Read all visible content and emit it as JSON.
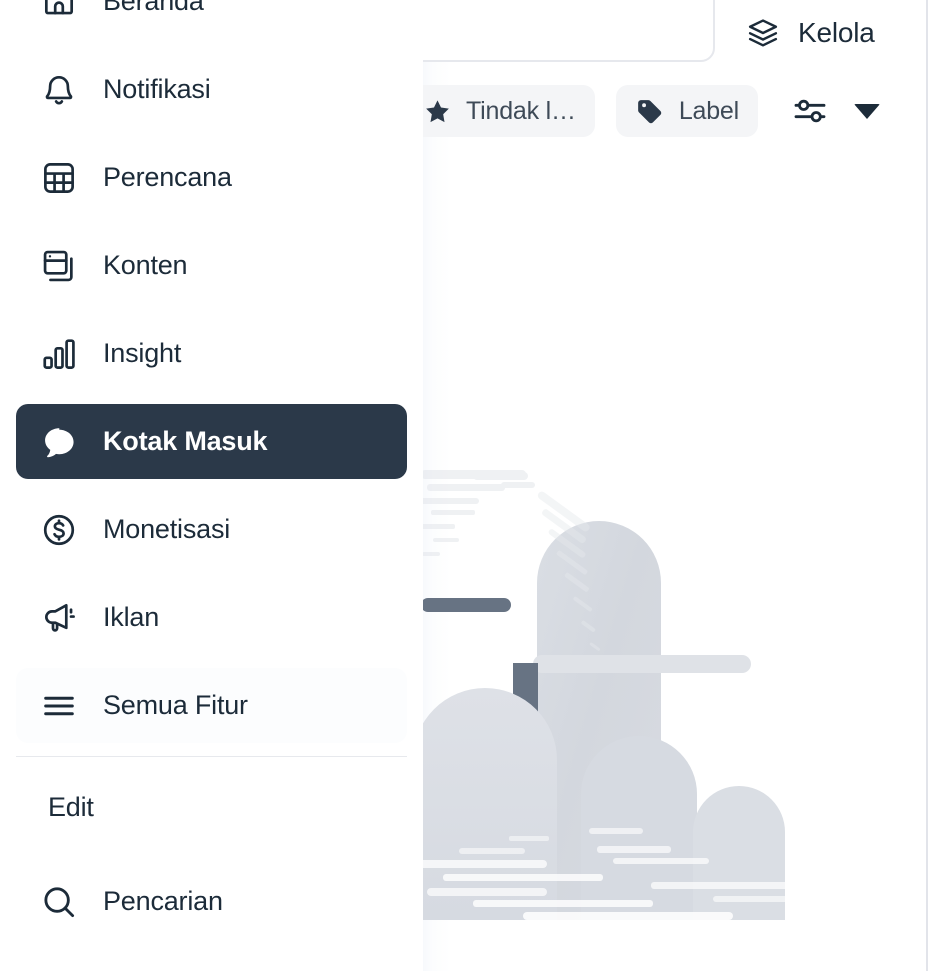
{
  "sidebar": {
    "items": [
      {
        "label": "Beranda",
        "icon": "home-icon",
        "state": "normal"
      },
      {
        "label": "Notifikasi",
        "icon": "bell-icon",
        "state": "normal"
      },
      {
        "label": "Perencana",
        "icon": "calendar-grid-icon",
        "state": "normal"
      },
      {
        "label": "Konten",
        "icon": "content-cards-icon",
        "state": "normal"
      },
      {
        "label": "Insight",
        "icon": "bar-chart-icon",
        "state": "normal"
      },
      {
        "label": "Kotak Masuk",
        "icon": "chat-bubble-icon",
        "state": "active"
      },
      {
        "label": "Monetisasi",
        "icon": "dollar-circle-icon",
        "state": "normal"
      },
      {
        "label": "Iklan",
        "icon": "megaphone-icon",
        "state": "normal"
      },
      {
        "label": "Semua Fitur",
        "icon": "hamburger-menu-icon",
        "state": "ghost"
      }
    ],
    "edit_label": "Edit",
    "search": {
      "label": "Pencarian",
      "icon": "search-icon"
    }
  },
  "header": {
    "manage": {
      "label": "Kelola",
      "icon": "layers-icon"
    }
  },
  "toolbar": {
    "actions": {
      "label": "Tindak l…",
      "icon": "star-icon"
    },
    "label_button": {
      "label": "Label",
      "icon": "tag-icon"
    },
    "filter": {
      "icon": "sliders-icon"
    },
    "dropdown": {
      "icon": "caret-down-icon"
    }
  },
  "empty_state": {
    "illustration": "mailbox-with-clouds-illustration",
    "colors": {
      "mailbox_body": "#d5d9e0",
      "mailbox_body_light": "#dcdfe5",
      "shelf": "#dfe2e7",
      "cloud": "#dadee4",
      "accent_slate": "#677383"
    }
  },
  "theme": {
    "text": "#1c2b39",
    "active_bg": "#2b3949",
    "active_text": "#ffffff",
    "pill_bg": "#f4f5f7",
    "divider": "#e7e9ed",
    "panel_bg": "#ffffff"
  }
}
